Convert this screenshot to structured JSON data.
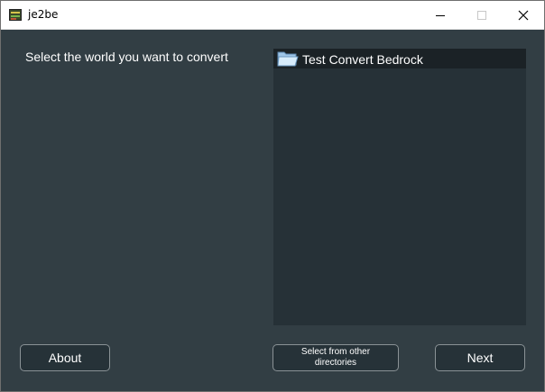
{
  "window": {
    "title": "je2be",
    "controls": {
      "minimize_icon": "minimize-icon",
      "maximize_icon": "maximize-icon",
      "close_icon": "close-icon"
    }
  },
  "main": {
    "prompt": "Select the world you want to convert",
    "worlds": [
      {
        "name": "Test Convert Bedrock",
        "icon": "folder-icon",
        "selected": true
      }
    ]
  },
  "buttons": {
    "about": "About",
    "select_other": "Select from other directories",
    "next": "Next"
  },
  "colors": {
    "background": "#323e44",
    "list_background": "#263137",
    "selected_row": "#1b2226",
    "button_border": "#8a9296",
    "text": "#ffffff"
  }
}
